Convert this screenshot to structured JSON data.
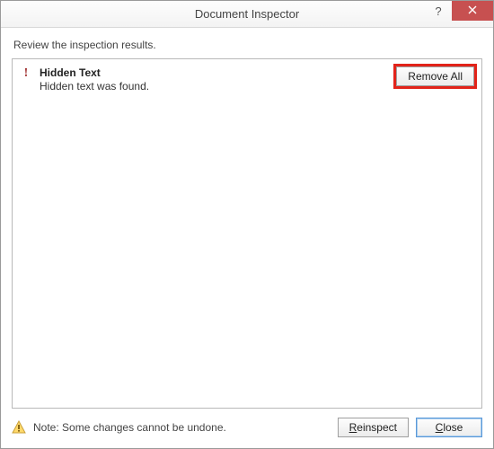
{
  "titlebar": {
    "title": "Document Inspector",
    "help_label": "?"
  },
  "instruction": "Review the inspection results.",
  "results": {
    "item": {
      "icon": "!",
      "title": "Hidden Text",
      "description": "Hidden text was found.",
      "action_label": "Remove All"
    }
  },
  "footer": {
    "note": "Note: Some changes cannot be undone.",
    "reinspect_label": "Reinspect",
    "close_label": "Close"
  }
}
